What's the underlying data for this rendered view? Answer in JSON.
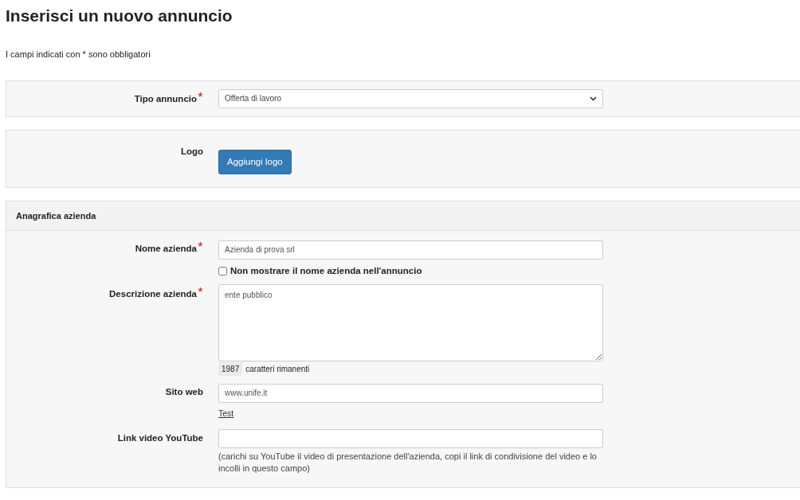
{
  "title": "Inserisci un nuovo annuncio",
  "note": "I campi indicati con * sono obbligatori",
  "panels": [
    {
      "fields": [
        {
          "kind": "select",
          "label": "Tipo annuncio",
          "required": true,
          "value": "Offerta di lavoro"
        }
      ]
    },
    {
      "fields": [
        {
          "kind": "button",
          "label": "Logo",
          "required": false,
          "button": "Aggiungi logo"
        }
      ]
    },
    {
      "heading": "Anagrafica azienda",
      "fields": [
        {
          "kind": "text",
          "label": "Nome azienda",
          "required": true,
          "value": "Azienda di prova srl",
          "checkbox": {
            "label": "Non mostrare il nome azienda nell'annuncio",
            "checked": false
          }
        },
        {
          "kind": "textarea",
          "label": "Descrizione azienda",
          "required": true,
          "value": "ente pubblico",
          "counter": "1987",
          "counter_label": "caratteri rimanenti"
        },
        {
          "kind": "text",
          "label": "Sito web",
          "required": false,
          "value": "www.unife.it",
          "link": "Test"
        },
        {
          "kind": "text",
          "label": "Link video YouTube",
          "required": false,
          "help": "(carichi su YouTube il video di presentazione dell'azienda, copi il link di condivisione del video e lo incolli in questo campo)"
        }
      ]
    }
  ]
}
